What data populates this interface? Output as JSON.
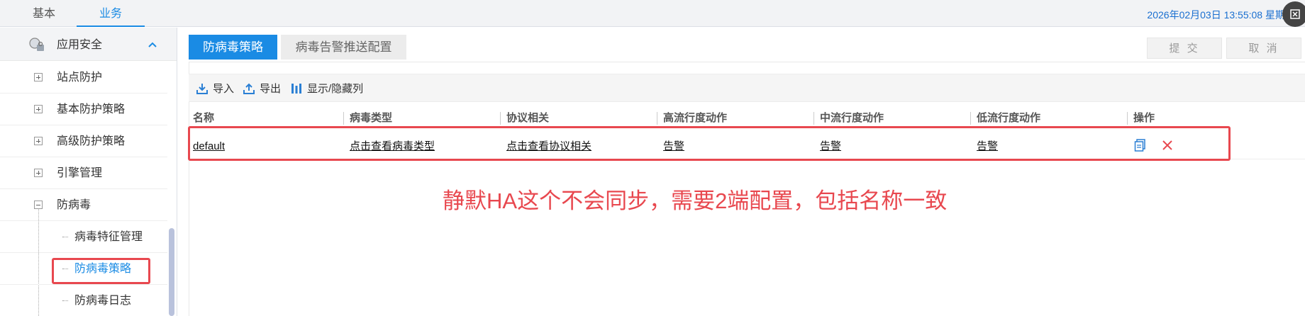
{
  "topbar": {
    "tabs": [
      {
        "label": "基本",
        "active": false
      },
      {
        "label": "业务",
        "active": true
      }
    ],
    "datetime": "2026年02月03日  13:55:08  星期"
  },
  "sidebar": {
    "section_title": "应用安全",
    "items": [
      {
        "label": "站点防护",
        "type": "plus"
      },
      {
        "label": "基本防护策略",
        "type": "plus"
      },
      {
        "label": "高级防护策略",
        "type": "plus"
      },
      {
        "label": "引擎管理",
        "type": "plus"
      },
      {
        "label": "防病毒",
        "type": "minus"
      }
    ],
    "subitems": [
      {
        "label": "病毒特征管理",
        "active": false
      },
      {
        "label": "防病毒策略",
        "active": true
      },
      {
        "label": "防病毒日志",
        "active": false
      }
    ]
  },
  "tabs": [
    {
      "label": "防病毒策略",
      "active": true
    },
    {
      "label": "病毒告警推送配置",
      "active": false
    }
  ],
  "actions": {
    "submit": "提 交",
    "cancel": "取 消"
  },
  "toolbar": {
    "import": "导入",
    "export": "导出",
    "toggle_columns": "显示/隐藏列"
  },
  "table": {
    "columns": [
      "名称",
      "病毒类型",
      "协议相关",
      "高流行度动作",
      "中流行度动作",
      "低流行度动作",
      "操作"
    ],
    "rows": [
      [
        "default",
        "点击查看病毒类型",
        "点击查看协议相关",
        "告警",
        "告警",
        "告警"
      ]
    ]
  },
  "annotation": "静默HA这个不会同步，需要2端配置，包括名称一致",
  "colors": {
    "accent": "#1a8be4",
    "highlight": "#e8484f"
  }
}
